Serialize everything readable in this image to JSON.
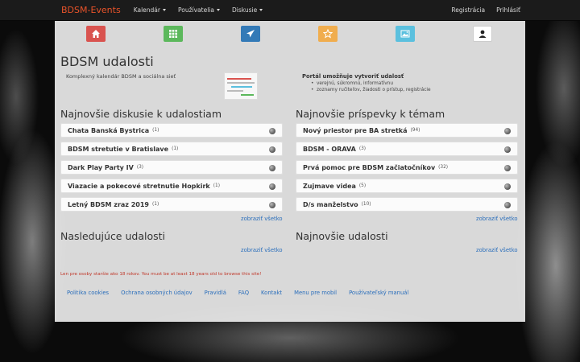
{
  "navbar": {
    "brand": "BDSM-Events",
    "menu": [
      {
        "label": "Kalendár"
      },
      {
        "label": "Používatelia"
      },
      {
        "label": "Diskusie"
      }
    ],
    "right": [
      {
        "label": "Registrácia"
      },
      {
        "label": "Prihlásiť"
      }
    ]
  },
  "iconbar": [
    {
      "icon": "home-icon",
      "color": "#d9534f"
    },
    {
      "icon": "grid-icon",
      "color": "#5cb85c"
    },
    {
      "icon": "paper-plane-icon",
      "color": "#337ab7"
    },
    {
      "icon": "star-icon",
      "color": "#f0ad4e"
    },
    {
      "icon": "picture-icon",
      "color": "#5bc0de"
    },
    {
      "icon": "user-icon",
      "color": "#ffffff"
    }
  ],
  "header": {
    "title": "BDSM udalosti",
    "subtitle": "Komplexný kalendár BDSM a sociálna sieť",
    "portal_title": "Portál umožňuje vytvoriť udalosť",
    "portal_items": [
      "verejnú, súkromnú, informatívnu",
      "zoznamy ručiteľov, žiadosti o prístup, registrácie"
    ]
  },
  "discussions": {
    "title": "Najnovšie diskusie k udalostiam",
    "items": [
      {
        "name": "Chata Banská Bystrica",
        "count": "(1)"
      },
      {
        "name": "BDSM stretutie v Bratislave",
        "count": "(1)"
      },
      {
        "name": "Dark Play Party IV",
        "count": "(3)"
      },
      {
        "name": "Viazacie a pokecové stretnutie Hopkirk",
        "count": "(1)"
      },
      {
        "name": "Letný BDSM zraz 2019",
        "count": "(1)"
      }
    ],
    "more": "zobraziť všetko"
  },
  "posts": {
    "title": "Najnovšie príspevky k témam",
    "items": [
      {
        "name": "Nový priestor pre BA stretká",
        "count": "(94)"
      },
      {
        "name": "BDSM - ORAVA",
        "count": "(3)"
      },
      {
        "name": "Prvá pomoc pre BDSM začiatočníkov",
        "count": "(32)"
      },
      {
        "name": "Zujmave videa",
        "count": "(5)"
      },
      {
        "name": "D/s manželstvo",
        "count": "(10)"
      }
    ],
    "more": "zobraziť všetko"
  },
  "upcoming": {
    "title": "Nasledujúce udalosti",
    "more": "zobraziť všetko"
  },
  "newest": {
    "title": "Najnovšie udalosti",
    "more": "zobraziť všetko"
  },
  "warning": "Len pre osoby staršie ako 18 rokov. You must be at least 18 years old to browse this site!",
  "footer": [
    "Politika cookies",
    "Ochrana osobných údajov",
    "Pravidlá",
    "FAQ",
    "Kontakt",
    "Menu pre mobil",
    "Používateľský manuál"
  ]
}
